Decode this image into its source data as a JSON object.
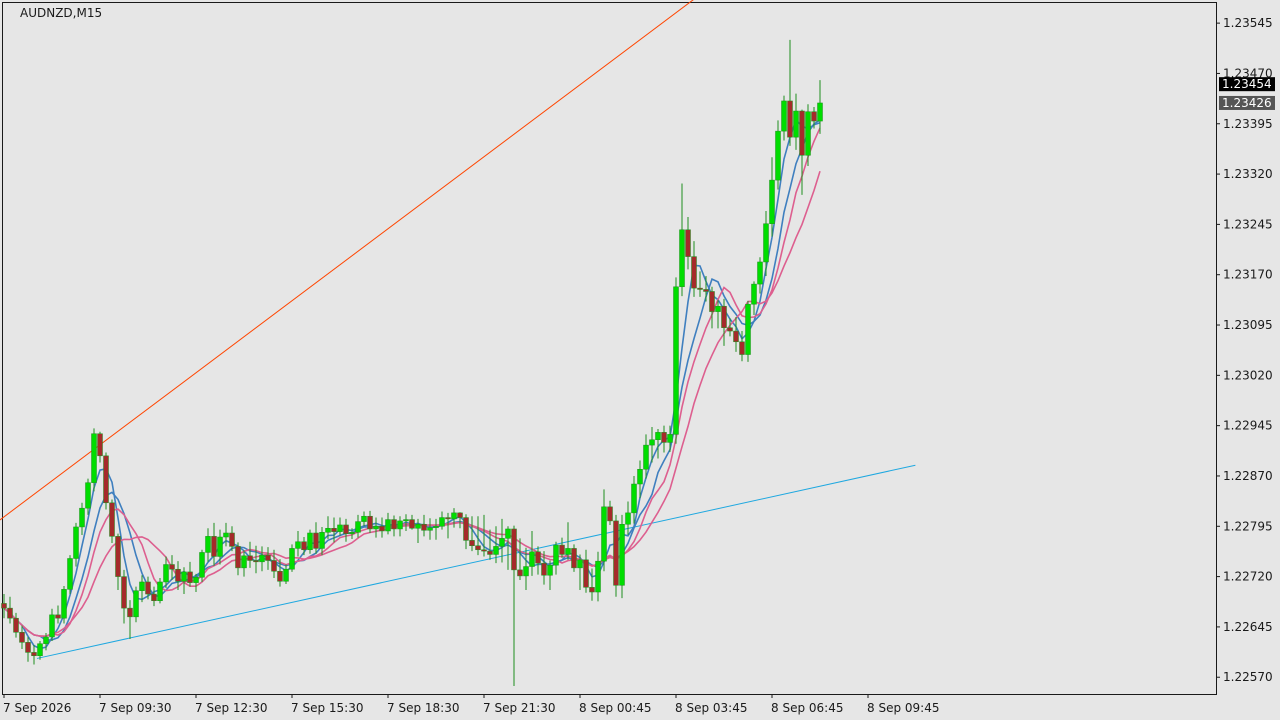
{
  "chart_data": {
    "type": "candlestick",
    "title": "AUDNZD,M15",
    "symbol": "AUDNZD",
    "timeframe": "M15",
    "ylim": [
      1.22545,
      1.23575
    ],
    "y_ticks": [
      "1.23545",
      "1.23470",
      "1.23395",
      "1.23320",
      "1.23245",
      "1.23170",
      "1.23095",
      "1.23020",
      "1.22945",
      "1.22870",
      "1.22795",
      "1.22720",
      "1.22645",
      "1.22570"
    ],
    "x_ticks": [
      "7 Sep 2026",
      "7 Sep 09:30",
      "7 Sep 12:30",
      "7 Sep 15:30",
      "7 Sep 18:30",
      "7 Sep 21:30",
      "8 Sep 00:45",
      "8 Sep 03:45",
      "8 Sep 06:45",
      "8 Sep 09:45"
    ],
    "price_tags": [
      {
        "value": 1.23454,
        "label": "1.23454",
        "color": "#000000"
      },
      {
        "value": 1.23426,
        "label": "1.23426",
        "color": "#555555"
      }
    ],
    "colors": {
      "background": "#e6e6e6",
      "bull": "#00dd00",
      "bear": "#a52a2a",
      "wick": "#1f8f1f",
      "ma_blue": "#3f7fbf",
      "ma_pink": "#dd5f8f",
      "trendline_upper": "#ff4500",
      "trendline_lower": "#1fa8e0"
    },
    "trendlines": [
      {
        "name": "upper",
        "from": [
          -2.1,
          1.22795
        ],
        "to": [
          115.5,
          1.23584
        ]
      },
      {
        "name": "lower",
        "from": [
          5.5,
          1.22598
        ],
        "to": [
          151.9,
          1.22886
        ]
      }
    ],
    "candles": [
      [
        1.2268,
        1.22694,
        1.22658,
        1.22673
      ],
      [
        1.22673,
        1.2269,
        1.2265,
        1.22658
      ],
      [
        1.22658,
        1.22666,
        1.22629,
        1.22637
      ],
      [
        1.22637,
        1.22647,
        1.22612,
        1.22622
      ],
      [
        1.22622,
        1.2263,
        1.22593,
        1.22607
      ],
      [
        1.22607,
        1.22618,
        1.22589,
        1.22602
      ],
      [
        1.22602,
        1.22624,
        1.22596,
        1.2262
      ],
      [
        1.2262,
        1.22636,
        1.2261,
        1.2263
      ],
      [
        1.2263,
        1.22672,
        1.22624,
        1.22663
      ],
      [
        1.22663,
        1.22677,
        1.2265,
        1.22658
      ],
      [
        1.22658,
        1.22706,
        1.2265,
        1.22701
      ],
      [
        1.22701,
        1.22752,
        1.22694,
        1.22747
      ],
      [
        1.22747,
        1.228,
        1.22735,
        1.22794
      ],
      [
        1.22794,
        1.2283,
        1.22782,
        1.22822
      ],
      [
        1.22822,
        1.22866,
        1.22812,
        1.2286
      ],
      [
        1.2286,
        1.22941,
        1.22847,
        1.22933
      ],
      [
        1.22933,
        1.22936,
        1.2289,
        1.229
      ],
      [
        1.229,
        1.22905,
        1.2282,
        1.2283
      ],
      [
        1.2283,
        1.22835,
        1.2277,
        1.2278
      ],
      [
        1.2278,
        1.22784,
        1.227,
        1.2272
      ],
      [
        1.2272,
        1.2273,
        1.2265,
        1.22673
      ],
      [
        1.22673,
        1.22685,
        1.22627,
        1.2266
      ],
      [
        1.2266,
        1.22705,
        1.22652,
        1.22699
      ],
      [
        1.22699,
        1.22722,
        1.22682,
        1.22712
      ],
      [
        1.22712,
        1.2272,
        1.22686,
        1.22694
      ],
      [
        1.22694,
        1.22705,
        1.22676,
        1.22684
      ],
      [
        1.22684,
        1.22718,
        1.2268,
        1.22712
      ],
      [
        1.22712,
        1.2275,
        1.22703,
        1.22738
      ],
      [
        1.22738,
        1.22752,
        1.22715,
        1.22731
      ],
      [
        1.22731,
        1.22743,
        1.227,
        1.22713
      ],
      [
        1.22713,
        1.22734,
        1.22694,
        1.22727
      ],
      [
        1.22727,
        1.22742,
        1.22705,
        1.22711
      ],
      [
        1.22711,
        1.22724,
        1.22697,
        1.22719
      ],
      [
        1.22719,
        1.2276,
        1.22712,
        1.22756
      ],
      [
        1.22756,
        1.22792,
        1.22742,
        1.2278
      ],
      [
        1.2278,
        1.228,
        1.22736,
        1.2275
      ],
      [
        1.2275,
        1.2279,
        1.22738,
        1.22779
      ],
      [
        1.22779,
        1.228,
        1.22765,
        1.22785
      ],
      [
        1.22785,
        1.22795,
        1.22758,
        1.22765
      ],
      [
        1.22765,
        1.22771,
        1.22722,
        1.22733
      ],
      [
        1.22733,
        1.22759,
        1.2272,
        1.22751
      ],
      [
        1.22751,
        1.22772,
        1.22733,
        1.22744
      ],
      [
        1.22744,
        1.22766,
        1.22725,
        1.22742
      ],
      [
        1.22742,
        1.22765,
        1.22728,
        1.22752
      ],
      [
        1.22752,
        1.22764,
        1.2273,
        1.22744
      ],
      [
        1.22744,
        1.2276,
        1.22718,
        1.22728
      ],
      [
        1.22728,
        1.22746,
        1.22705,
        1.22713
      ],
      [
        1.22713,
        1.22738,
        1.22709,
        1.22731
      ],
      [
        1.22731,
        1.22768,
        1.22727,
        1.22762
      ],
      [
        1.22762,
        1.22788,
        1.2275,
        1.22772
      ],
      [
        1.22772,
        1.22779,
        1.22752,
        1.2276
      ],
      [
        1.2276,
        1.2279,
        1.22754,
        1.22785
      ],
      [
        1.22785,
        1.22801,
        1.22754,
        1.22762
      ],
      [
        1.22762,
        1.22794,
        1.22752,
        1.22786
      ],
      [
        1.22786,
        1.2281,
        1.22776,
        1.22792
      ],
      [
        1.22792,
        1.22808,
        1.22771,
        1.22787
      ],
      [
        1.22787,
        1.22808,
        1.22781,
        1.22797
      ],
      [
        1.22797,
        1.22806,
        1.22772,
        1.22784
      ],
      [
        1.22784,
        1.22792,
        1.22776,
        1.22786
      ],
      [
        1.22786,
        1.22812,
        1.22778,
        1.22802
      ],
      [
        1.22802,
        1.22817,
        1.22795,
        1.2281
      ],
      [
        1.2281,
        1.22818,
        1.22785,
        1.22791
      ],
      [
        1.22791,
        1.22808,
        1.22778,
        1.22795
      ],
      [
        1.22795,
        1.22808,
        1.22778,
        1.22788
      ],
      [
        1.22788,
        1.22815,
        1.22783,
        1.22805
      ],
      [
        1.22805,
        1.22811,
        1.2278,
        1.22791
      ],
      [
        1.22791,
        1.2281,
        1.2278,
        1.22803
      ],
      [
        1.22803,
        1.22813,
        1.22788,
        1.22805
      ],
      [
        1.22805,
        1.22812,
        1.2279,
        1.22792
      ],
      [
        1.22792,
        1.22806,
        1.2277,
        1.22798
      ],
      [
        1.22798,
        1.22812,
        1.2278,
        1.22789
      ],
      [
        1.22789,
        1.22807,
        1.22775,
        1.22793
      ],
      [
        1.22793,
        1.22806,
        1.22775,
        1.22795
      ],
      [
        1.22795,
        1.22817,
        1.2279,
        1.22808
      ],
      [
        1.22808,
        1.22815,
        1.22777,
        1.22806
      ],
      [
        1.22806,
        1.22822,
        1.22793,
        1.22815
      ],
      [
        1.22815,
        1.22816,
        1.22792,
        1.22808
      ],
      [
        1.22808,
        1.22813,
        1.22761,
        1.22774
      ],
      [
        1.22774,
        1.2281,
        1.22758,
        1.22766
      ],
      [
        1.22766,
        1.2281,
        1.22752,
        1.2276
      ],
      [
        1.2276,
        1.22812,
        1.2275,
        1.22758
      ],
      [
        1.22758,
        1.2279,
        1.22745,
        1.22753
      ],
      [
        1.22753,
        1.22795,
        1.2274,
        1.22765
      ],
      [
        1.22765,
        1.22806,
        1.22741,
        1.22777
      ],
      [
        1.22777,
        1.22795,
        1.2273,
        1.22791
      ],
      [
        1.22791,
        1.22796,
        1.22557,
        1.2273
      ],
      [
        1.2273,
        1.22777,
        1.22715,
        1.22721
      ],
      [
        1.22721,
        1.22763,
        1.227,
        1.22735
      ],
      [
        1.22735,
        1.22788,
        1.22721,
        1.22757
      ],
      [
        1.22757,
        1.22765,
        1.22723,
        1.2274
      ],
      [
        1.2274,
        1.22758,
        1.22708,
        1.22722
      ],
      [
        1.22722,
        1.22744,
        1.227,
        1.22737
      ],
      [
        1.22737,
        1.22772,
        1.22723,
        1.22767
      ],
      [
        1.22767,
        1.22778,
        1.22748,
        1.22753
      ],
      [
        1.22753,
        1.22801,
        1.22745,
        1.22762
      ],
      [
        1.22762,
        1.22768,
        1.22727,
        1.22733
      ],
      [
        1.22733,
        1.22753,
        1.227,
        1.22745
      ],
      [
        1.22745,
        1.2276,
        1.22696,
        1.22704
      ],
      [
        1.22704,
        1.22732,
        1.22684,
        1.22697
      ],
      [
        1.22697,
        1.22757,
        1.22683,
        1.22743
      ],
      [
        1.22743,
        1.2285,
        1.22728,
        1.22824
      ],
      [
        1.22824,
        1.22833,
        1.22797,
        1.22803
      ],
      [
        1.22803,
        1.22812,
        1.2269,
        1.22707
      ],
      [
        1.22707,
        1.22812,
        1.22688,
        1.22798
      ],
      [
        1.22798,
        1.22832,
        1.22782,
        1.22815
      ],
      [
        1.22815,
        1.2287,
        1.22799,
        1.22858
      ],
      [
        1.22858,
        1.22893,
        1.22837,
        1.2288
      ],
      [
        1.2288,
        1.22932,
        1.22866,
        1.22916
      ],
      [
        1.22916,
        1.22943,
        1.2289,
        1.22924
      ],
      [
        1.22924,
        1.2294,
        1.22896,
        1.22935
      ],
      [
        1.22935,
        1.22945,
        1.22905,
        1.2292
      ],
      [
        1.2292,
        1.22945,
        1.22906,
        1.22932
      ],
      [
        1.22932,
        1.23166,
        1.22918,
        1.23152
      ],
      [
        1.23152,
        1.23306,
        1.23138,
        1.23237
      ],
      [
        1.23237,
        1.23256,
        1.23178,
        1.23197
      ],
      [
        1.23197,
        1.2322,
        1.23137,
        1.2315
      ],
      [
        1.2315,
        1.23175,
        1.23137,
        1.23148
      ],
      [
        1.23148,
        1.23168,
        1.2313,
        1.23145
      ],
      [
        1.23145,
        1.23152,
        1.2309,
        1.23115
      ],
      [
        1.23115,
        1.23132,
        1.2309,
        1.23123
      ],
      [
        1.23123,
        1.23134,
        1.23064,
        1.23091
      ],
      [
        1.23091,
        1.23105,
        1.23078,
        1.23086
      ],
      [
        1.23086,
        1.23107,
        1.23055,
        1.2307
      ],
      [
        1.2307,
        1.23086,
        1.23041,
        1.23051
      ],
      [
        1.23051,
        1.23131,
        1.2304,
        1.23126
      ],
      [
        1.23126,
        1.2316,
        1.2311,
        1.23156
      ],
      [
        1.23156,
        1.23196,
        1.23142,
        1.23189
      ],
      [
        1.23189,
        1.23265,
        1.23168,
        1.23246
      ],
      [
        1.23246,
        1.23345,
        1.23227,
        1.23311
      ],
      [
        1.23311,
        1.234,
        1.23297,
        1.23384
      ],
      [
        1.23384,
        1.23437,
        1.2337,
        1.23429
      ],
      [
        1.23429,
        1.2352,
        1.23362,
        1.23375
      ],
      [
        1.23375,
        1.2344,
        1.23356,
        1.23414
      ],
      [
        1.23414,
        1.23416,
        1.23289,
        1.23348
      ],
      [
        1.23348,
        1.23424,
        1.23332,
        1.23413
      ],
      [
        1.23413,
        1.2342,
        1.23388,
        1.23399
      ],
      [
        1.23399,
        1.2346,
        1.2338,
        1.23426
      ]
    ]
  }
}
